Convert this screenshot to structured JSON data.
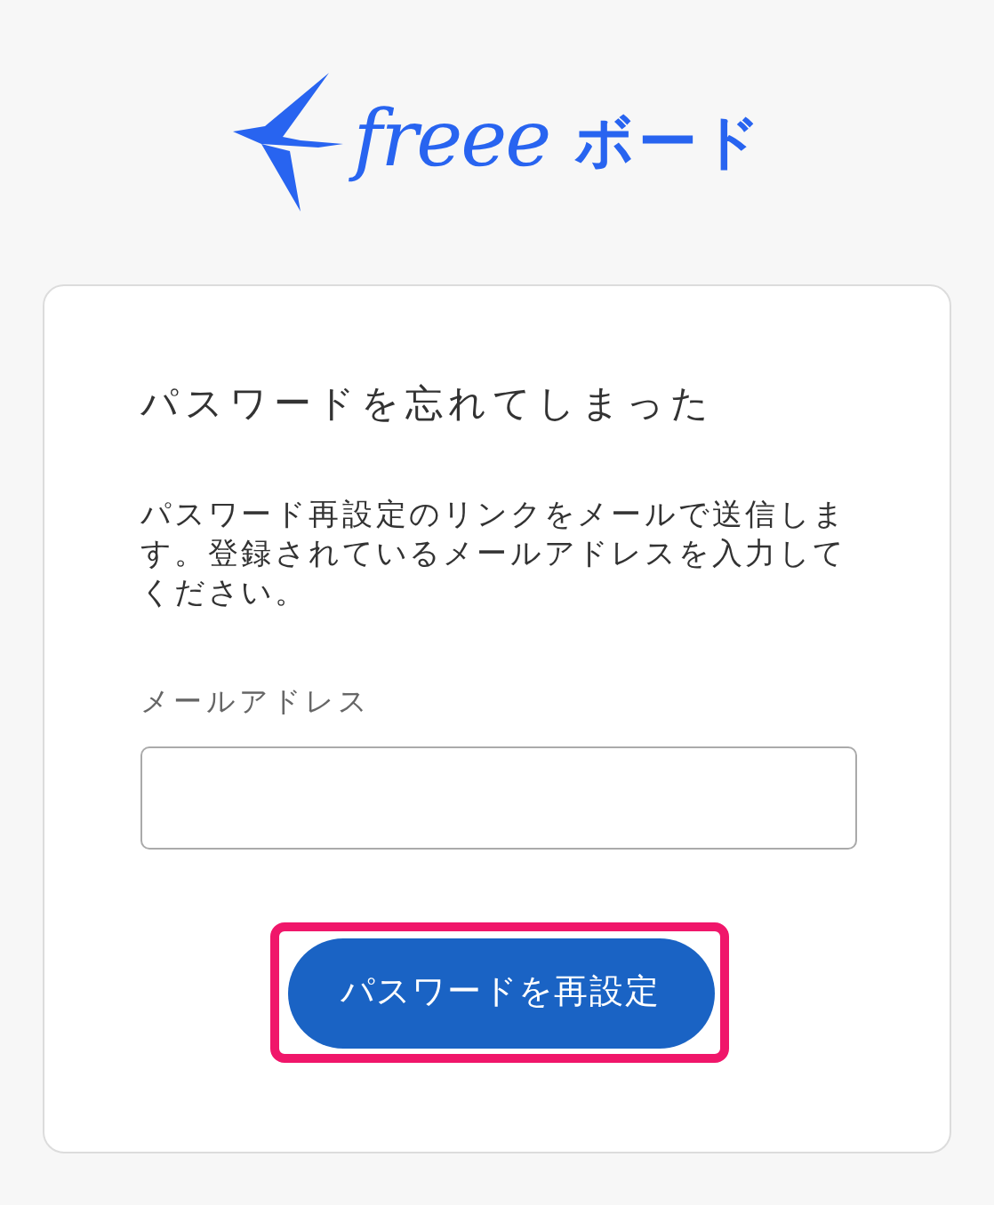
{
  "logo": {
    "brand": "freee",
    "product": "ボード"
  },
  "card": {
    "title": "パスワードを忘れてしまった",
    "description": "パスワード再設定のリンクをメールで送信します。登録されているメールアドレスを入力してください。",
    "email_field": {
      "label": "メールアドレス"
    },
    "submit_button": {
      "label": "パスワードを再設定",
      "highlighted": true
    }
  }
}
